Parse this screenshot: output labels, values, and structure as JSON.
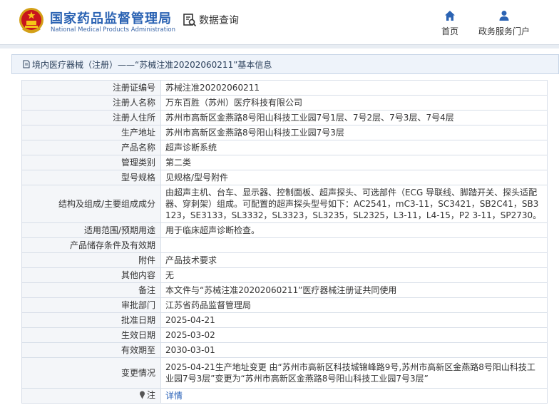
{
  "header": {
    "brand_cn": "国家药品监督管理局",
    "brand_en": "National Medical Products Administration",
    "query_label": "数据查询",
    "nav": [
      {
        "label": "首页",
        "icon": "home-icon"
      },
      {
        "label": "政务服务门户",
        "icon": "user-icon"
      }
    ]
  },
  "title": "境内医疗器械（注册）——“苏械注准20202060211”基本信息",
  "colors": {
    "brand": "#2b63b3",
    "label_bg": "#f4f6f9",
    "border": "#d7dee8",
    "link": "#2a62b8"
  },
  "rows": [
    {
      "label": "注册证编号",
      "value": "苏械注准20202060211"
    },
    {
      "label": "注册人名称",
      "value": "万东百胜（苏州）医疗科技有限公司"
    },
    {
      "label": "注册人住所",
      "value": "苏州市高新区金燕路8号阳山科技工业园7号1层、7号2层、7号3层、7号4层"
    },
    {
      "label": "生产地址",
      "value": "苏州市高新区金燕路8号阳山科技工业园7号3层"
    },
    {
      "label": "产品名称",
      "value": "超声诊断系统"
    },
    {
      "label": "管理类别",
      "value": "第二类"
    },
    {
      "label": "型号规格",
      "value": "见规格/型号附件"
    },
    {
      "label": "结构及组成/主要组成成分",
      "value": "由超声主机、台车、显示器、控制面板、超声探头、可选部件（ECG 导联线、脚踏开关、探头适配器、穿刺架）组成。可配置的超声探头型号如下：AC2541，mC3-11，SC3421，SB2C41，SB3123，SE3133，SL3332，SL3323，SL3235，SL2325，L3-11，L4-15，P2 3-11，SP2730。"
    },
    {
      "label": "适用范围/预期用途",
      "value": "用于临床超声诊断检查。"
    },
    {
      "label": "产品储存条件及有效期",
      "value": ""
    },
    {
      "label": "附件",
      "value": "产品技术要求"
    },
    {
      "label": "其他内容",
      "value": "无"
    },
    {
      "label": "备注",
      "value": "本文件与“苏械注准20202060211”医疗器械注册证共同使用"
    },
    {
      "label": "审批部门",
      "value": "江苏省药品监督管理局"
    },
    {
      "label": "批准日期",
      "value": "2025-04-21"
    },
    {
      "label": "生效日期",
      "value": "2025-03-02"
    },
    {
      "label": "有效期至",
      "value": "2030-03-01"
    },
    {
      "label": "变更情况",
      "value": "2025-04-21生产地址变更 由“苏州市高新区科技城锦峰路9号,苏州市高新区金燕路8号阳山科技工业园7号3层”变更为“苏州市高新区金燕路8号阳山科技工业园7号3层”"
    }
  ],
  "note": {
    "label": "注",
    "link": "详情"
  }
}
